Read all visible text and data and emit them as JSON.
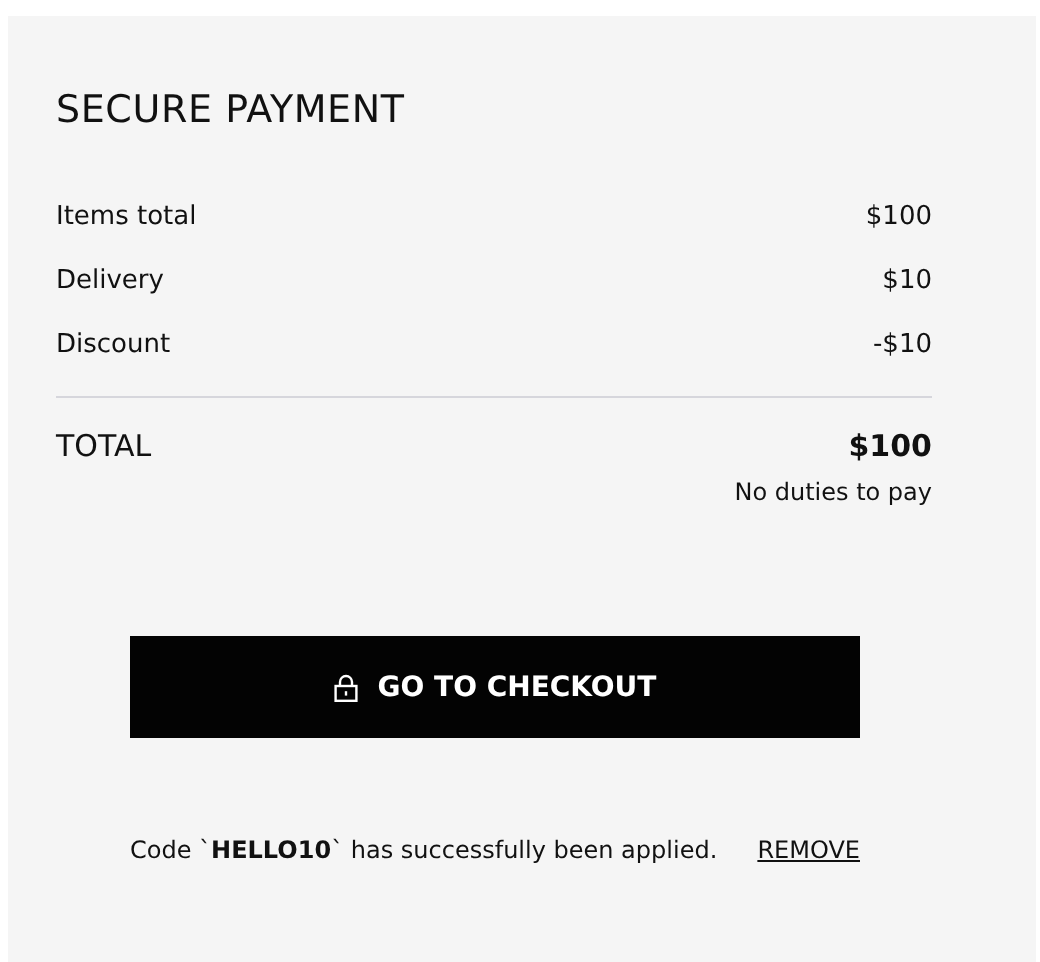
{
  "title": "SECURE PAYMENT",
  "summary": [
    {
      "label": "Items total",
      "value": "$100"
    },
    {
      "label": "Delivery",
      "value": "$10"
    },
    {
      "label": "Discount",
      "value": "-$10"
    }
  ],
  "total": {
    "label": "TOTAL",
    "value": "$100",
    "note": "No duties to pay"
  },
  "checkout_button": "GO TO CHECKOUT",
  "promo": {
    "message": "Code `**HELLO10**` has successfully been applied.",
    "action": "REMOVE"
  }
}
